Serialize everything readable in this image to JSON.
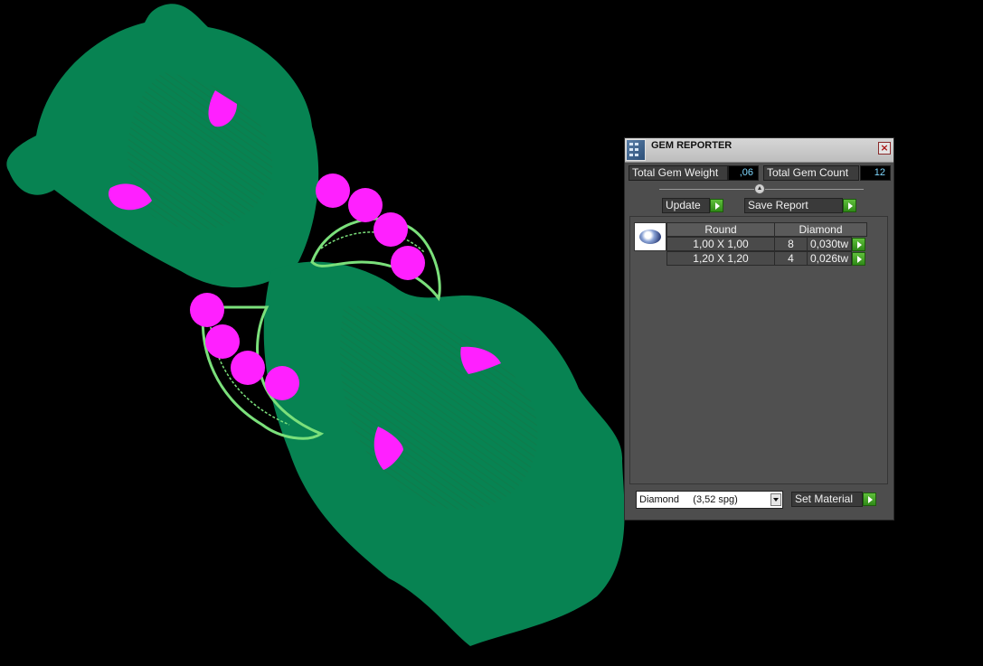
{
  "panel": {
    "title": "GEM REPORTER",
    "total_weight_label": "Total Gem Weight",
    "total_weight_value": ",06",
    "total_count_label": "Total Gem Count",
    "total_count_value": "12",
    "update_label": "Update",
    "save_report_label": "Save Report",
    "table": {
      "headers": [
        "Round",
        "Diamond"
      ],
      "rows": [
        {
          "size": "1,00 X 1,00",
          "count": "8",
          "weight": "0,030tw"
        },
        {
          "size": "1,20 X 1,20",
          "count": "4",
          "weight": "0,026tw"
        }
      ]
    },
    "material_value": "Diamond     (3,52 spg)",
    "set_material_label": "Set Material"
  },
  "colors": {
    "viewport_bg": "#000000",
    "model_body": "#078352",
    "wire": "#7be07b",
    "gem": "#ff20ff",
    "accent_green": "#3fa820"
  },
  "icons": {
    "app": "gem-reporter-icon",
    "close": "close-icon",
    "go": "green-arrow-icon",
    "dropdown": "chevron-down-icon"
  }
}
